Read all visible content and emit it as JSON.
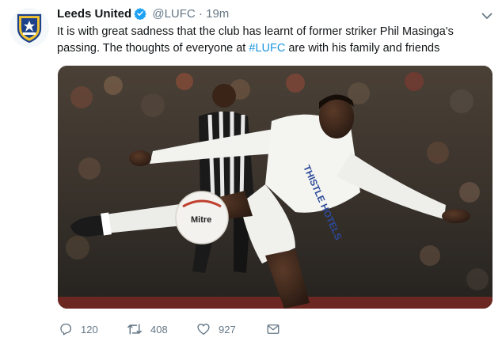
{
  "tweet": {
    "account_name": "Leeds United",
    "handle": "@LUFC",
    "separator": "·",
    "time": "19m",
    "text_before": "It is with great sadness that the club has learnt of former striker Phil Masinga's passing. The thoughts of everyone at ",
    "hashtag": "#LUFC",
    "text_after": " are with his family and friends",
    "media": {
      "shirt_sponsor": "THISTLE HOTELS",
      "ball_brand": "Mitre"
    }
  },
  "actions": {
    "replies": "120",
    "retweets": "408",
    "likes": "927"
  },
  "colors": {
    "verified_badge": "#1da1f2",
    "hashtag": "#1b95e0",
    "secondary_text": "#657786"
  },
  "icons": {
    "avatar": "leeds-united-crest-icon",
    "verified": "verified-badge-icon",
    "more": "chevron-down-icon",
    "reply": "reply-icon",
    "retweet": "retweet-icon",
    "like": "heart-icon",
    "message": "envelope-icon"
  }
}
